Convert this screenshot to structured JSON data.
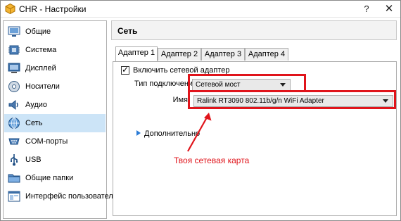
{
  "window": {
    "title": "CHR - Настройки",
    "help_glyph": "?",
    "close_glyph": "✕"
  },
  "sidebar": {
    "items": [
      {
        "label": "Общие",
        "icon": "general-icon",
        "selected": false
      },
      {
        "label": "Система",
        "icon": "system-icon",
        "selected": false
      },
      {
        "label": "Дисплей",
        "icon": "display-icon",
        "selected": false
      },
      {
        "label": "Носители",
        "icon": "storage-icon",
        "selected": false
      },
      {
        "label": "Аудио",
        "icon": "audio-icon",
        "selected": false
      },
      {
        "label": "Сеть",
        "icon": "network-icon",
        "selected": true
      },
      {
        "label": "COM-порты",
        "icon": "serial-ports-icon",
        "selected": false
      },
      {
        "label": "USB",
        "icon": "usb-icon",
        "selected": false
      },
      {
        "label": "Общие папки",
        "icon": "shared-folders-icon",
        "selected": false
      },
      {
        "label": "Интерфейс пользователя",
        "icon": "user-interface-icon",
        "selected": false
      }
    ]
  },
  "main": {
    "title": "Сеть",
    "tabs": [
      {
        "label": "Адаптер 1",
        "active": true
      },
      {
        "label": "Адаптер 2",
        "active": false
      },
      {
        "label": "Адаптер 3",
        "active": false
      },
      {
        "label": "Адаптер 4",
        "active": false
      }
    ],
    "enable_checkbox": {
      "label": "Включить сетевой адаптер",
      "checked": true
    },
    "attached_to": {
      "label": "Тип подключения",
      "value": "Сетевой мост"
    },
    "name": {
      "label": "Имя",
      "value": "Ralink RT3090 802.11b/g/n WiFi Adapter"
    },
    "advanced_label": "Дополнительно"
  },
  "annotation": {
    "text": "Твоя сетевая карта",
    "color": "#e0141b"
  },
  "colors": {
    "selection": "#cce4f7",
    "accent_red": "#e0141b",
    "disclosure_blue": "#2a7bd6"
  }
}
